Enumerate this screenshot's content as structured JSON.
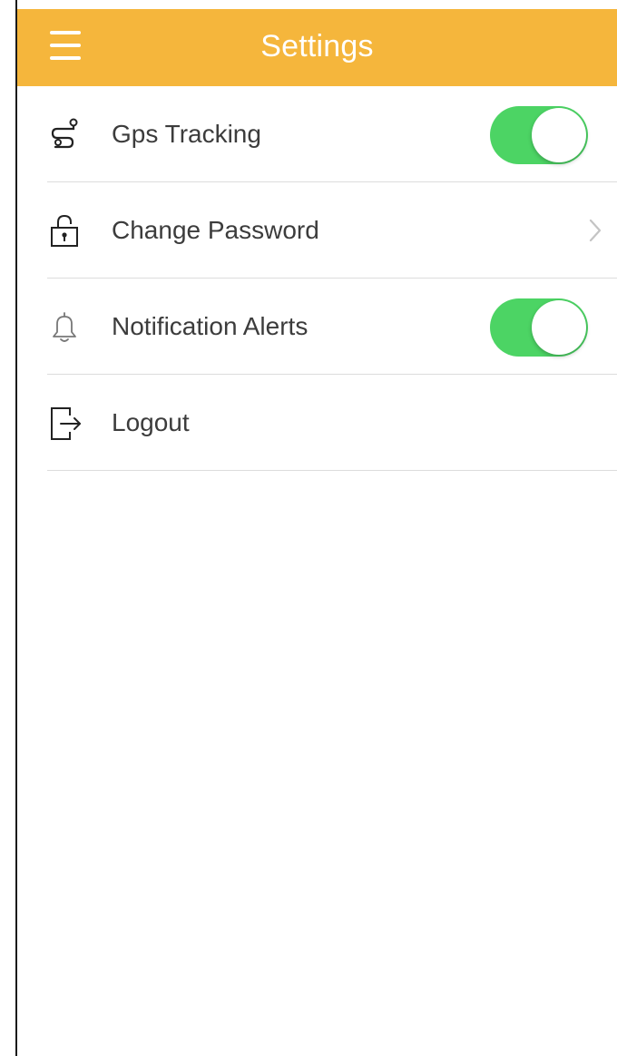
{
  "header": {
    "title": "Settings",
    "menu_icon": "hamburger-menu-icon",
    "background_color": "#f5b63c"
  },
  "settings": {
    "items": [
      {
        "label": "Gps Tracking",
        "icon": "route-icon",
        "control": "toggle",
        "enabled": true
      },
      {
        "label": "Change Password",
        "icon": "lock-icon",
        "control": "chevron",
        "chevron_icon": "chevron-right-icon"
      },
      {
        "label": "Notification Alerts",
        "icon": "bell-icon",
        "control": "toggle",
        "enabled": true
      },
      {
        "label": "Logout",
        "icon": "logout-icon",
        "control": "none"
      }
    ]
  },
  "colors": {
    "toggle_on": "#4cd464",
    "divider": "#dcdcdc",
    "label_text": "#3c3c3c"
  }
}
